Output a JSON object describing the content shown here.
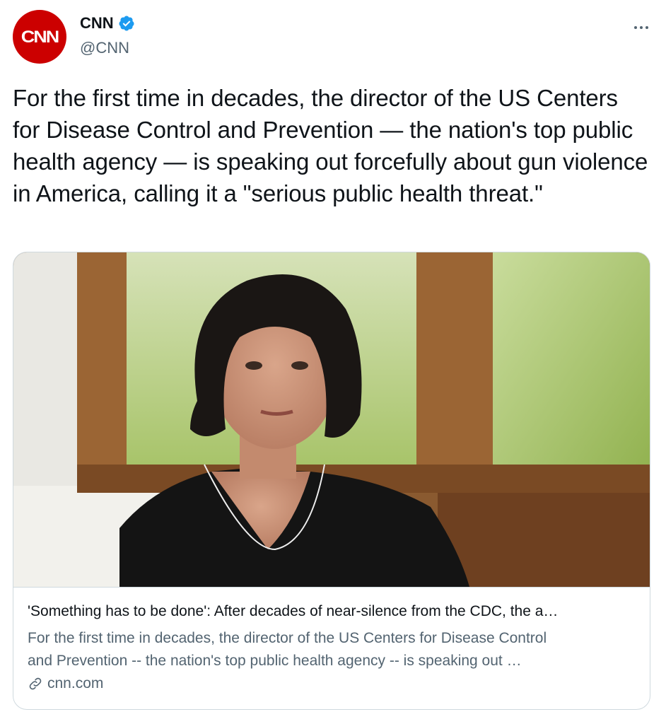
{
  "tweet": {
    "author": {
      "avatar_text": "CNN",
      "display_name": "CNN",
      "handle": "@CNN",
      "verified": true,
      "avatar_color": "#cc0000"
    },
    "text": "For the first time in decades, the director of the US Centers for Disease Control and Prevention — the nation's top public health agency — is speaking out forcefully about gun violence in America, calling it a \"serious public health threat.\"",
    "more_icon": "more-horizontal-icon",
    "card": {
      "image_icon": "article-photo",
      "title": "'Something has to be done': After decades of near-silence from the CDC, the a…",
      "description_line1": "For the first time in decades, the director of the US Centers for Disease Control",
      "description_line2": "and Prevention -- the nation's top public health agency -- is speaking out …",
      "domain": "cnn.com",
      "domain_icon": "link-icon"
    }
  },
  "colors": {
    "text_primary": "#0f1419",
    "text_secondary": "#536471",
    "verified_blue": "#1d9bf0",
    "border": "#cfd9de"
  }
}
